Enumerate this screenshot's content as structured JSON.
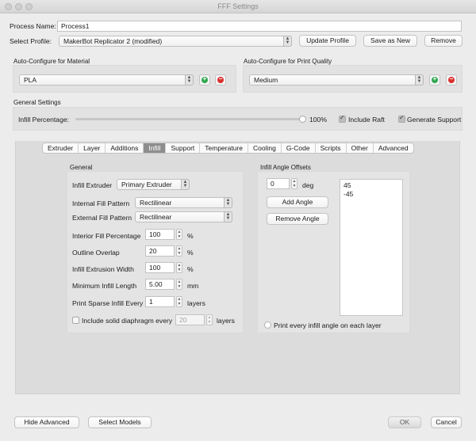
{
  "window": {
    "title": "FFF Settings"
  },
  "process": {
    "name_label": "Process Name:",
    "name_value": "Process1",
    "profile_label": "Select Profile:",
    "profile_value": "MakerBot Replicator 2 (modified)"
  },
  "top_buttons": {
    "update": "Update Profile",
    "save_as_new": "Save as New",
    "remove": "Remove"
  },
  "material": {
    "title": "Auto-Configure for Material",
    "value": "PLA"
  },
  "quality": {
    "title": "Auto-Configure for Print Quality",
    "value": "Medium"
  },
  "general_settings": {
    "title": "General Settings",
    "infill_label": "Infill Percentage:",
    "infill_value": "100%",
    "infill_fraction": 1.0,
    "raft_label": "Include Raft",
    "support_label": "Generate Support"
  },
  "tabs": [
    "Extruder",
    "Layer",
    "Additions",
    "Infill",
    "Support",
    "Temperature",
    "Cooling",
    "G-Code",
    "Scripts",
    "Other",
    "Advanced"
  ],
  "active_tab": "Infill",
  "general": {
    "title": "General",
    "infill_extruder_label": "Infill Extruder",
    "infill_extruder_value": "Primary Extruder",
    "internal_pattern_label": "Internal Fill Pattern",
    "internal_pattern_value": "Rectilinear",
    "external_pattern_label": "External Fill Pattern",
    "external_pattern_value": "Rectilinear",
    "interior_pct_label": "Interior Fill Percentage",
    "interior_pct_value": "100",
    "outline_overlap_label": "Outline Overlap",
    "outline_overlap_value": "20",
    "extrusion_width_label": "Infill Extrusion Width",
    "extrusion_width_value": "100",
    "min_length_label": "Minimum Infill Length",
    "min_length_value": "5.00",
    "sparse_label": "Print Sparse Infill Every",
    "sparse_value": "1",
    "diaphragm_label": "Include solid diaphragm every",
    "diaphragm_value": "20",
    "unit_pct": "%",
    "unit_mm": "mm",
    "unit_layers": "layers"
  },
  "angles": {
    "title": "Infill Angle Offsets",
    "angle_value": "0",
    "unit_deg": "deg",
    "add_label": "Add Angle",
    "remove_label": "Remove Angle",
    "list": [
      "45",
      "-45"
    ],
    "every_layer_label": "Print every infill angle on each layer"
  },
  "bottom_buttons": {
    "hide_advanced": "Hide Advanced",
    "select_models": "Select Models",
    "ok": "OK",
    "cancel": "Cancel"
  }
}
